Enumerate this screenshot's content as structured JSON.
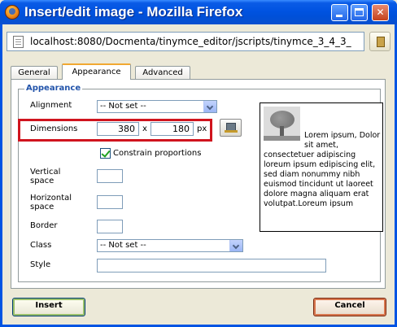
{
  "window": {
    "title": "Insert/edit image - Mozilla Firefox",
    "url": "localhost:8080/Docmenta/tinymce_editor/jscripts/tinymce_3_4_3_"
  },
  "tabs": [
    {
      "label": "General",
      "active": false
    },
    {
      "label": "Appearance",
      "active": true
    },
    {
      "label": "Advanced",
      "active": false
    }
  ],
  "appearance": {
    "legend": "Appearance",
    "alignment": {
      "label": "Alignment",
      "value": "-- Not set --"
    },
    "dimensions": {
      "label": "Dimensions",
      "width": "380",
      "separator": "x",
      "height": "180",
      "unit": "px"
    },
    "constrain": {
      "label": "Constrain proportions",
      "checked": true
    },
    "vertical_space": {
      "label_line1": "Vertical",
      "label_line2": "space",
      "value": ""
    },
    "horizontal_space": {
      "label_line1": "Horizontal",
      "label_line2": "space",
      "value": ""
    },
    "border": {
      "label": "Border",
      "value": ""
    },
    "class": {
      "label": "Class",
      "value": "-- Not set --"
    },
    "style": {
      "label": "Style",
      "value": ""
    },
    "preview_text": "Lorem ipsum, Dolor sit amet, consectetuer adipiscing loreum ipsum edipiscing elit, sed diam nonummy nibh euismod tincidunt ut laoreet dolore magna aliquam erat volutpat.Loreum ipsum"
  },
  "buttons": {
    "insert": "Insert",
    "cancel": "Cancel"
  },
  "colors": {
    "titlebar": "#0054e3",
    "highlight_border": "#d0141e",
    "legend": "#2153aa"
  }
}
